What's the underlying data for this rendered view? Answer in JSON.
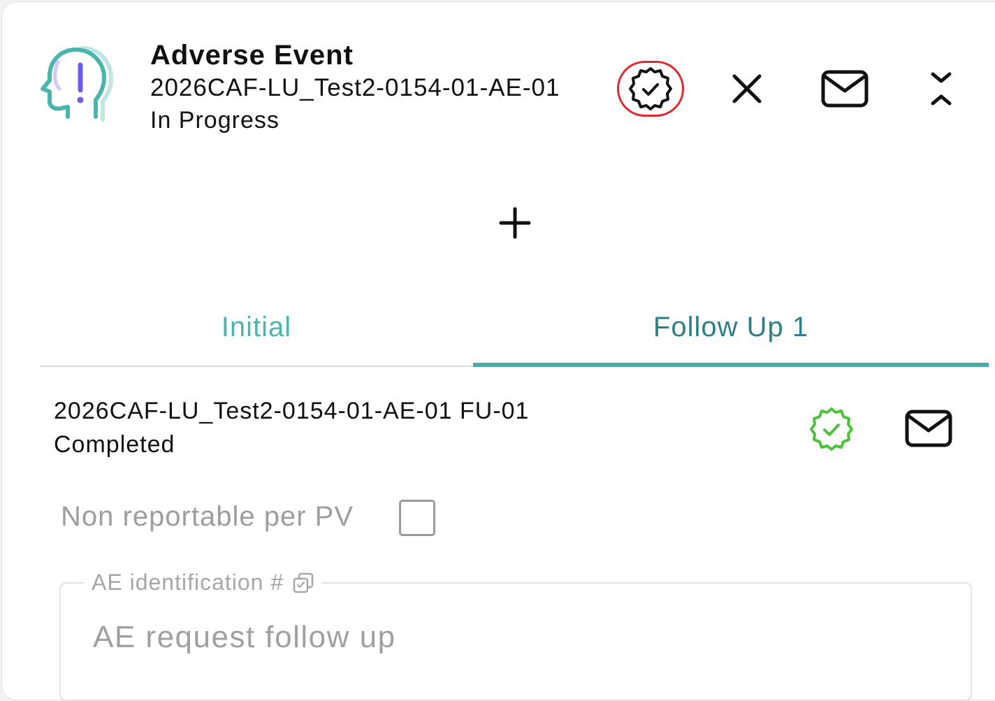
{
  "header": {
    "title": "Adverse Event",
    "case_id": "2026CAF-LU_Test2-0154-01-AE-01",
    "status": "In Progress",
    "icons": {
      "type": "head-alert-icon",
      "verify": "verified-badge-icon",
      "close": "close-icon",
      "mail": "mail-icon",
      "collapse": "collapse-icon"
    }
  },
  "add": {
    "icon": "plus-icon"
  },
  "tabs": [
    {
      "label": "Initial",
      "active": false
    },
    {
      "label": "Follow Up 1",
      "active": true
    }
  ],
  "follow_up": {
    "id": "2026CAF-LU_Test2-0154-01-AE-01 FU-01",
    "status": "Completed",
    "verified_color": "#4cc43a"
  },
  "form": {
    "non_reportable_label": "Non reportable per PV",
    "non_reportable_checked": false,
    "ae_identification_label": "AE identification #",
    "ae_identification_value": "AE request follow up"
  },
  "colors": {
    "accent": "#4aa9a6",
    "alert_purple": "#6b5fe6",
    "highlight_red": "#e0282c"
  }
}
